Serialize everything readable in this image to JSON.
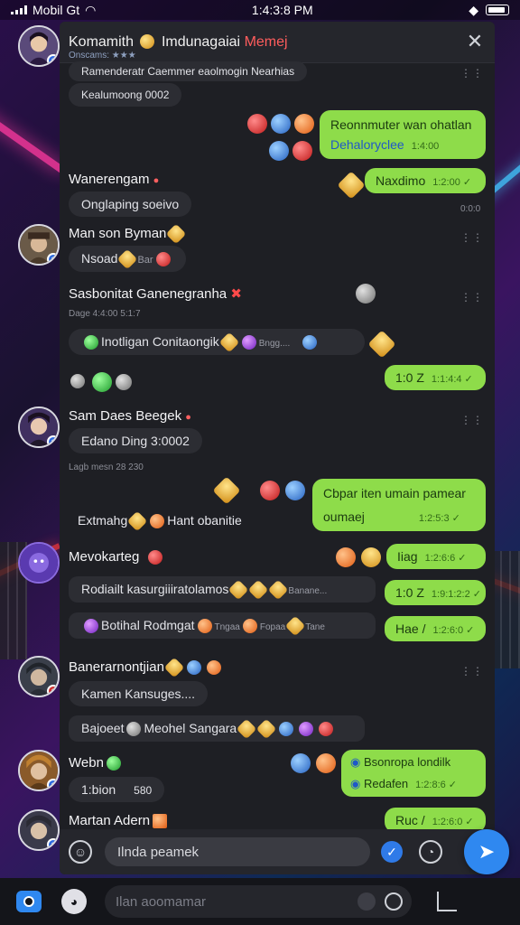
{
  "status_bar": {
    "carrier": "Mobil Gt",
    "time": "1:4:3:8 PM"
  },
  "chat": {
    "title_main": "Komamith",
    "title_rest": "Imdunagaiai",
    "title_highlight": "Memej",
    "subtitle": "Onscams: ★★★"
  },
  "messages": {
    "m1": "Ramenderatr Caemmer eaolmogin Nearhias",
    "m2": "Kealumoong 0002",
    "out1_l1": "Reonnmuter wan ohatlan",
    "out1_l2": "Dehaloryclee",
    "out1_time": "1:4:00",
    "out2": "Naxdimo",
    "out2_time": "1:2:00",
    "out2_meta": "0:0:0",
    "s1_name": "Wanerengam",
    "s1_msg": "Onglaping soeivo",
    "s2_name": "Man son Byman",
    "s2_msg": "Nsoad",
    "s2_msg_rest": "Bar",
    "s3_name": "Sasbonitat Ganenegranha",
    "s3_meta": "Dage 4:4:00 5:1:7",
    "s3_msg": "Inotligan Conitaongik",
    "s3_msg_rest": "Bngg....",
    "out3": "1:0 Z",
    "out3_time": "1:1:4:4",
    "s4_name": "Sam Daes Beegek",
    "s4_msg": "Edano Ding 3:0002",
    "s4_meta": "Lagb mesn 28 230",
    "out4_l1": "Cbpar iten umain pamear",
    "out4_l2": "oumaej",
    "out4_time": "1:2:5:3",
    "s5_line": "Extmahg",
    "s5_line_rest": "Hant obanitie",
    "s6_name": "Mevokarteg",
    "out5": "Iiag",
    "out5_time": "1:2:6:6",
    "s6_msg1": "Rodiailt kasurgiiiratolamos",
    "s6_msg1_rest": "Banane...",
    "out6": "1:0 Z",
    "out6_time": "1:9:1:2:2",
    "s6_msg2": "Botihal Rodmgat",
    "s6_msg2_a": "Tngaa",
    "s6_msg2_b": "Fopaa",
    "s6_msg2_c": "Tane",
    "out7": "Hae /",
    "out7_time": "1:2:6:0",
    "s7_name": "Banerarnontjian",
    "s7_msg1": "Kamen Kansuges....",
    "s7_msg2": "Bajoeet",
    "s7_msg2_rest": "Meohel Sangara",
    "s8_name": "Webn",
    "s8_msg": "1:bion",
    "s8_msg_rest": "580",
    "out8_l1": "Bsonropa londilk",
    "out8_l2": "Redafen",
    "out8_time": "1:2:8:6",
    "s9_name": "Martan Adern",
    "out9": "Ruc /",
    "out9_time": "1:2:6:0"
  },
  "composer": {
    "placeholder": "Ilnda peamek"
  },
  "bottom_bar": {
    "placeholder": "Ilan aoomamar"
  }
}
